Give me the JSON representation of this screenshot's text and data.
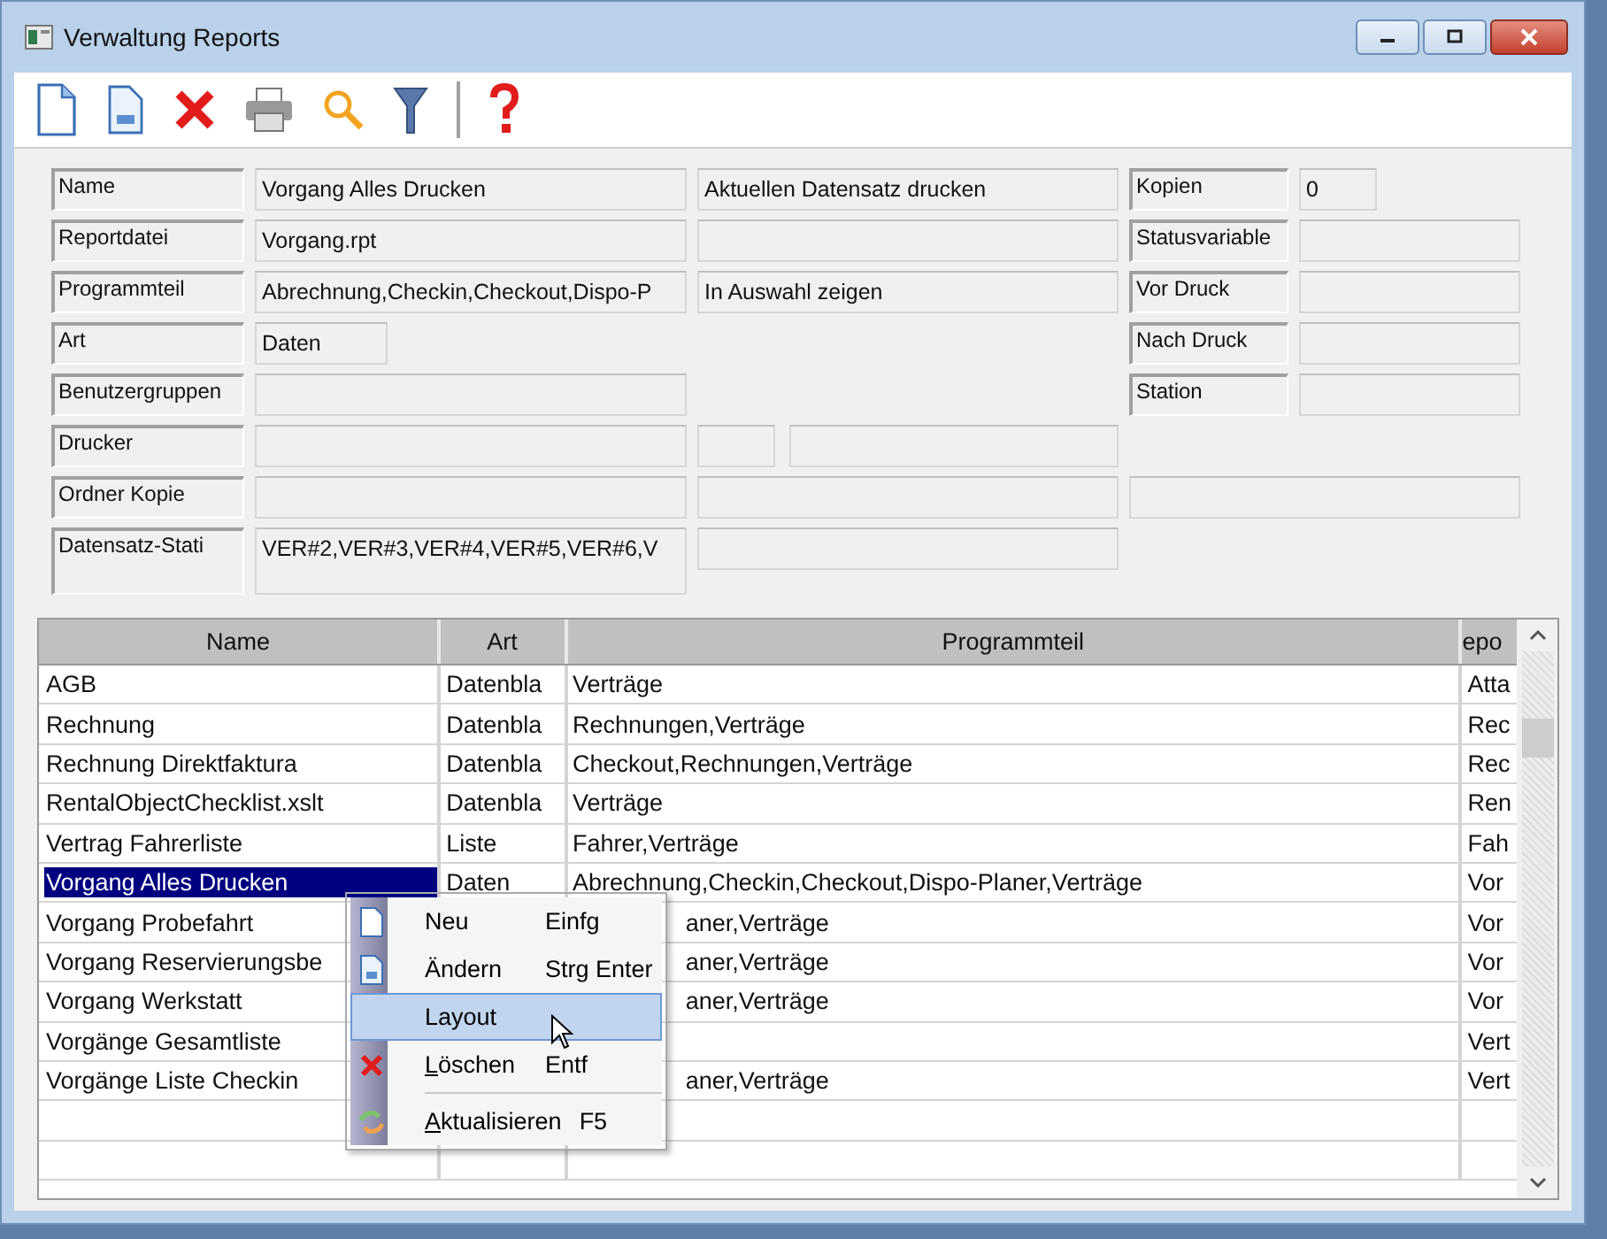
{
  "window": {
    "title": "Verwaltung Reports"
  },
  "form": {
    "left": [
      {
        "label": "Name",
        "value": "Vorgang Alles Drucken"
      },
      {
        "label": "Reportdatei",
        "value": "Vorgang.rpt"
      },
      {
        "label": "Programmteil",
        "value": "Abrechnung,Checkin,Checkout,Dispo-P"
      },
      {
        "label": "Art",
        "value": "Daten"
      },
      {
        "label": "Benutzergruppen"
      },
      {
        "label": "Drucker"
      },
      {
        "label": "Ordner Kopie"
      },
      {
        "label": "Datensatz-Stati",
        "value": "VER#2,VER#3,VER#4,VER#5,VER#6,V"
      }
    ],
    "options": [
      "Aktuellen Datensatz drucken",
      "In Auswahl zeigen"
    ],
    "right": [
      {
        "label": "Kopien",
        "value": "0"
      },
      {
        "label": "Statusvariable"
      },
      {
        "label": "Vor Druck"
      },
      {
        "label": "Nach Druck"
      },
      {
        "label": "Station"
      }
    ]
  },
  "table": {
    "columns": [
      "Name",
      "Art",
      "Programmteil",
      "epo"
    ],
    "rows": [
      {
        "name": "AGB",
        "art": "Datenbla",
        "programmteil": "Verträge",
        "column_4": "Atta",
        "selected": false
      },
      {
        "name": "Rechnung",
        "art": "Datenbla",
        "programmteil": "Rechnungen,Verträge",
        "column_4": "Rec",
        "selected": false
      },
      {
        "name": "Rechnung Direktfaktura",
        "art": "Datenbla",
        "programmteil": "Checkout,Rechnungen,Verträge",
        "column_4": "Rec",
        "selected": false
      },
      {
        "name": "RentalObjectChecklist.xslt",
        "art": "Datenbla",
        "programmteil": "Verträge",
        "column_4": "Ren",
        "selected": false
      },
      {
        "name": "Vertrag Fahrerliste",
        "art": "Liste",
        "programmteil": "Fahrer,Verträge",
        "column_4": "Fah",
        "selected": false
      },
      {
        "name": "Vorgang Alles Drucken",
        "art": "Daten",
        "programmteil": "Abrechnung,Checkin,Checkout,Dispo-Planer,Verträge",
        "column_4": "Vor",
        "selected": true
      },
      {
        "name": "Vorgang Probefahrt",
        "programmteil": "aner,Verträge",
        "covered": true,
        "column_4": "Vor",
        "selected": false
      },
      {
        "name": "Vorgang Reservierungsbe",
        "programmteil": "aner,Verträge",
        "covered": true,
        "column_4": "Vor",
        "selected": false
      },
      {
        "name": "Vorgang Werkstatt",
        "programmteil": "aner,Verträge",
        "covered": true,
        "column_4": "Vor",
        "selected": false
      },
      {
        "name": "Vorgänge Gesamtliste",
        "column_4": "Vert",
        "selected": false
      },
      {
        "name": "Vorgänge Liste Checkin",
        "programmteil": "aner,Verträge",
        "covered": true,
        "column_4": "Vert",
        "selected": false
      }
    ]
  },
  "context_menu": [
    {
      "kind": "new",
      "label": "Neu",
      "shortcut": "Einfg",
      "selected": false,
      "mnemonic": false
    },
    {
      "kind": "edit",
      "label": "Ändern",
      "shortcut": "Strg Enter",
      "selected": false,
      "mnemonic": false
    },
    {
      "kind": "plain",
      "label": "Layout",
      "selected": true,
      "mnemonic": false
    },
    {
      "kind": "delete",
      "label": "Löschen",
      "shortcut": "Entf",
      "selected": false,
      "mnemonic": true
    },
    {
      "kind": "refresh",
      "label": "Aktualisieren",
      "shortcut": "F5",
      "selected": false,
      "mnemonic": true
    }
  ]
}
